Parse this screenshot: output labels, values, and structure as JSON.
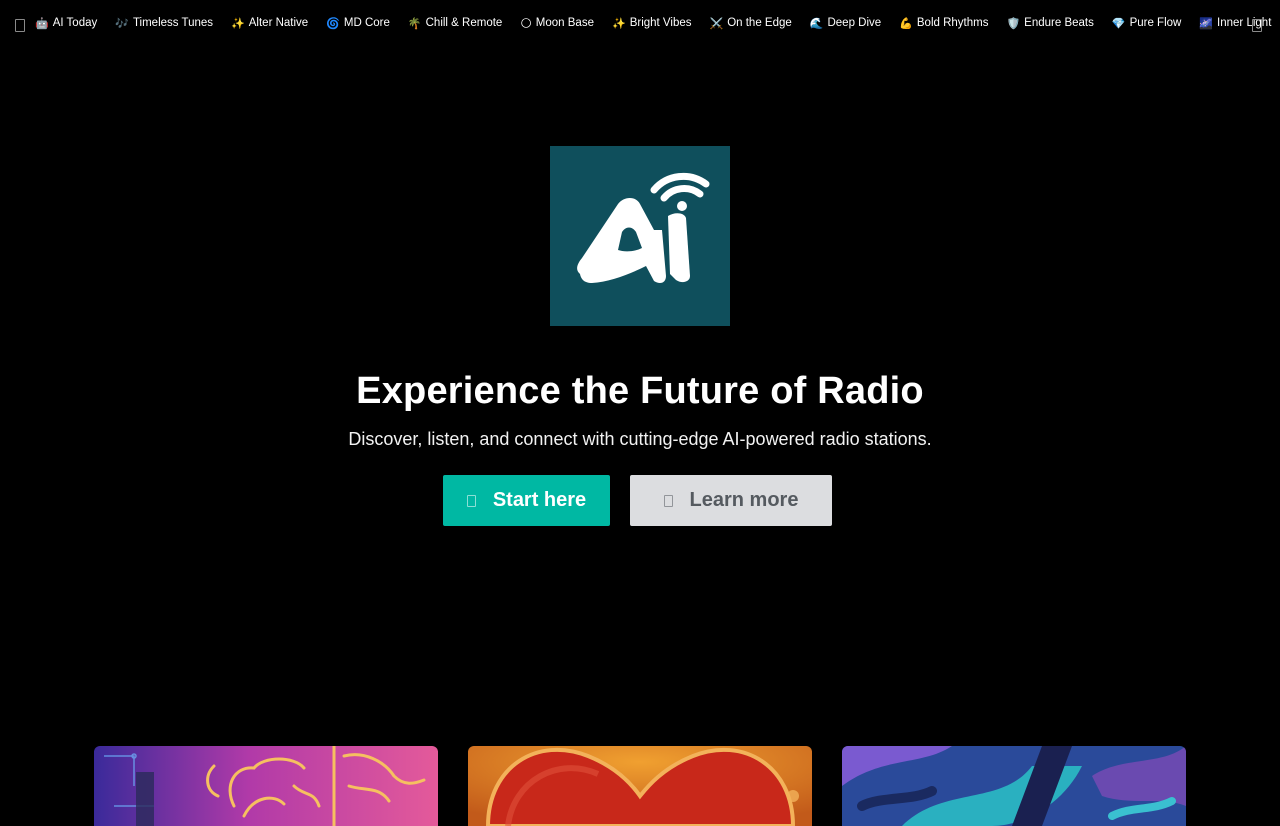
{
  "nav": {
    "stations": [
      {
        "emoji": "🤖",
        "label": "AI Today"
      },
      {
        "emoji": "🎶",
        "label": "Timeless Tunes"
      },
      {
        "emoji": "✨",
        "label": "Alter Native"
      },
      {
        "emoji": "🌀",
        "label": "MD Core"
      },
      {
        "emoji": "🌴",
        "label": "Chill & Remote"
      },
      {
        "emoji": "🌕",
        "label": "Moon Base"
      },
      {
        "emoji": "✨",
        "label": "Bright Vibes"
      },
      {
        "emoji": "⚔️",
        "label": "On the Edge"
      },
      {
        "emoji": "🌊",
        "label": "Deep Dive"
      },
      {
        "emoji": "💪",
        "label": "Bold Rhythms"
      },
      {
        "emoji": "🛡️",
        "label": "Endure Beats"
      },
      {
        "emoji": "💎",
        "label": "Pure Flow"
      },
      {
        "emoji": "🌌",
        "label": "Inner Light"
      }
    ]
  },
  "hero": {
    "title": "Experience the Future of Radio",
    "subtitle": "Discover, listen, and connect with cutting-edge AI-powered radio stations.",
    "primary_button": "Start here",
    "secondary_button": "Learn more"
  },
  "colors": {
    "background": "#000000",
    "logo_bg": "#0f4f5c",
    "primary": "#00b8a3",
    "secondary": "#dcdde0"
  }
}
